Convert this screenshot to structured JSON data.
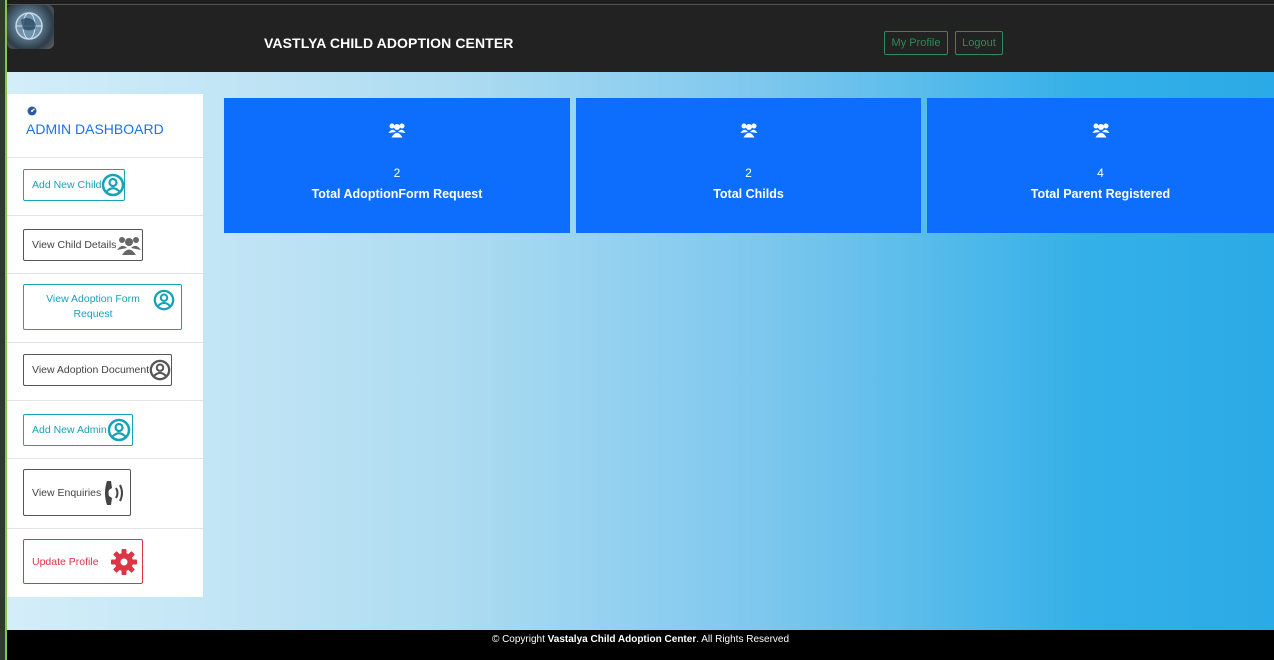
{
  "header": {
    "title": "VASTLYA CHILD ADOPTION CENTER",
    "my_profile": "My Profile",
    "logout": "Logout",
    "logo_icon": "globe-logo-icon"
  },
  "sidebar": {
    "title": "ADMIN DASHBOARD",
    "title_icon": "dashboard-icon",
    "items": [
      {
        "label": "Add New Child",
        "icon": "user-circle-icon",
        "style": "cyan"
      },
      {
        "label": "View Child Details",
        "icon": "users-icon",
        "style": "dark"
      },
      {
        "label": "View Adoption Form Request",
        "icon": "user-circle-icon",
        "style": "cyan"
      },
      {
        "label": "View Adoption Document",
        "icon": "user-circle-icon",
        "style": "dark"
      },
      {
        "label": "Add New Admin",
        "icon": "user-circle-icon",
        "style": "cyan"
      },
      {
        "label": "View Enquiries",
        "icon": "phone-icon",
        "style": "dark"
      },
      {
        "label": "Update Profile",
        "icon": "gear-icon",
        "style": "red"
      }
    ]
  },
  "stats": [
    {
      "count": "2",
      "label": "Total AdoptionForm Request",
      "icon": "users-icon"
    },
    {
      "count": "2",
      "label": "Total Childs",
      "icon": "users-icon"
    },
    {
      "count": "4",
      "label": "Total Parent Registered",
      "icon": "users-icon"
    }
  ],
  "footer": {
    "prefix": "© Copyright ",
    "brand": "Vastalya Child Adoption Center",
    "suffix": ". All Rights Reserved"
  },
  "colors": {
    "card_blue": "#0d6efd",
    "accent_cyan": "#17a2b8",
    "danger_red": "#dc3545",
    "header_bg": "#222222",
    "header_btn_green": "#2e8b57"
  }
}
